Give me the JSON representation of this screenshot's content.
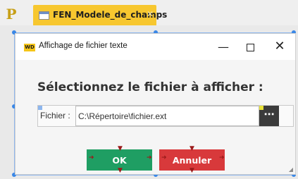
{
  "app": {
    "logo_letter": "P"
  },
  "tab": {
    "label": "FEN_Modele_de_champs",
    "close_glyph": "✕"
  },
  "window": {
    "badge": "WD",
    "title": "Affichage de fichier texte",
    "minimize_glyph": "—",
    "close_glyph": "✕"
  },
  "main": {
    "heading": "Sélectionnez le fichier à afficher :",
    "field_label": "Fichier :",
    "field_value": "C:\\Répertoire\\fichier.ext",
    "browse_label": "⋯"
  },
  "buttons": {
    "ok": "OK",
    "cancel": "Annuler"
  },
  "colors": {
    "tab": "#f7c72f",
    "ok": "#1f9e63",
    "cancel": "#d8393b",
    "browse": "#3b3b3b",
    "selection": "#3a87e6"
  }
}
